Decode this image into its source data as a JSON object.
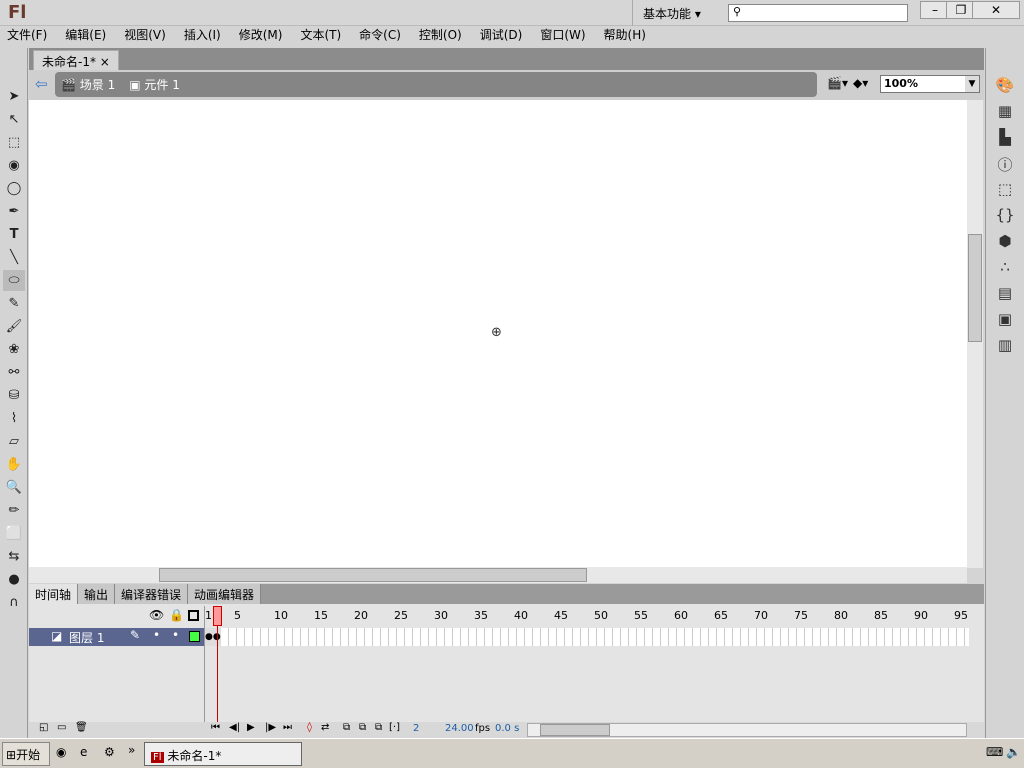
{
  "app": {
    "logo": "Fl",
    "workspace": "基本功能",
    "search_placeholder": ""
  },
  "menu": [
    "文件(F)",
    "编辑(E)",
    "视图(V)",
    "插入(I)",
    "修改(M)",
    "文本(T)",
    "命令(C)",
    "控制(O)",
    "调试(D)",
    "窗口(W)",
    "帮助(H)"
  ],
  "document": {
    "tab": "未命名-1*",
    "close": "×"
  },
  "breadcrumb": {
    "scene": "场景 1",
    "symbol": "元件 1"
  },
  "zoom": "100%",
  "timeline": {
    "tabs": [
      "时间轴",
      "输出",
      "编译器错误",
      "动画编辑器"
    ],
    "ruler": [
      "1",
      "5",
      "10",
      "15",
      "20",
      "25",
      "30",
      "35",
      "40",
      "45",
      "50",
      "55",
      "60",
      "65",
      "70",
      "75",
      "80",
      "85",
      "90",
      "95"
    ],
    "layer": "图层 1",
    "current_frame": "2",
    "fps": "24.00",
    "fps_unit": "fps",
    "time": "0.0 s"
  },
  "taskbar": {
    "start": "开始",
    "task": "未命名-1*",
    "task_icon": "Fl"
  }
}
